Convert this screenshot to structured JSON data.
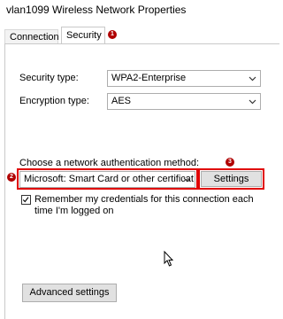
{
  "window": {
    "title": "vlan1099 Wireless Network Properties"
  },
  "tabs": [
    {
      "label": "Connection"
    },
    {
      "label": "Security"
    }
  ],
  "badges": {
    "tab": "1",
    "auth_method": "2",
    "settings": "3"
  },
  "security": {
    "security_type_label": "Security type:",
    "security_type_value": "WPA2-Enterprise",
    "encryption_type_label": "Encryption type:",
    "encryption_type_value": "AES",
    "auth_method_label": "Choose a network authentication method:",
    "auth_method_value": "Microsoft: Smart Card or other certificat",
    "settings_button": "Settings",
    "remember_credentials_label_line1": "Remember my credentials for this connection each",
    "remember_credentials_label_line2": "time I'm logged on",
    "remember_credentials_checked": true,
    "advanced_settings_button": "Advanced settings"
  },
  "colors": {
    "highlight": "#e00000",
    "badge": "#b00000"
  },
  "icons": {
    "dropdown": "chevron-down-icon",
    "checkmark": "checkmark-icon",
    "cursor": "mouse-cursor-icon"
  }
}
